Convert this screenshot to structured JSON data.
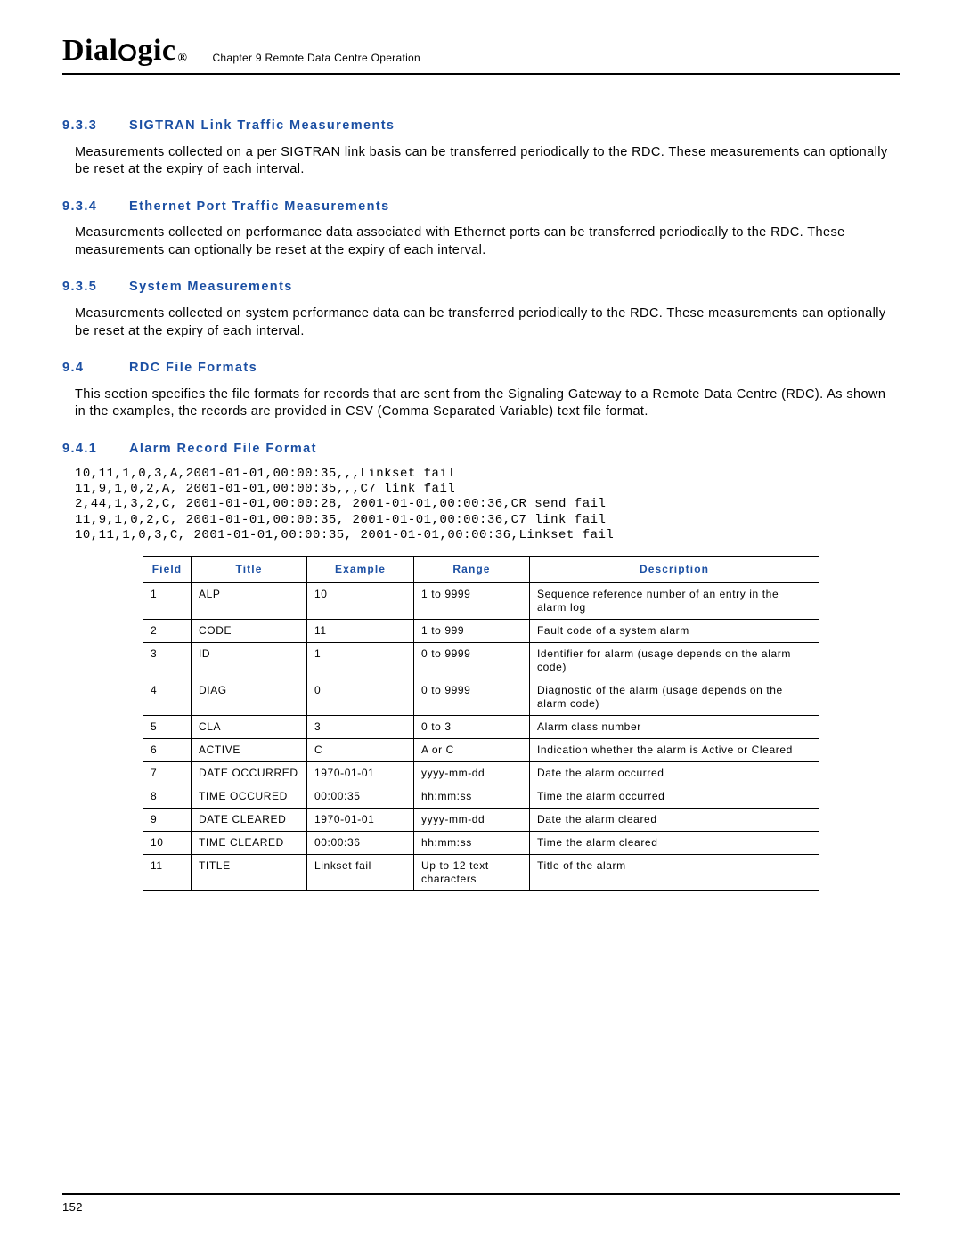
{
  "header": {
    "logo_pre": "Dial",
    "logo_post": "gic",
    "reg_mark": "®",
    "chapter_ref": "Chapter 9 Remote Data Centre Operation"
  },
  "sections": {
    "s933": {
      "num": "9.3.3",
      "title": "SIGTRAN Link Traffic Measurements",
      "body": "Measurements collected on a per SIGTRAN link basis can be transferred periodically to the RDC. These measurements can optionally be reset at the expiry of each interval."
    },
    "s934": {
      "num": "9.3.4",
      "title": "Ethernet Port Traffic Measurements",
      "body": "Measurements collected on performance data associated with Ethernet ports can be transferred periodically to the RDC. These measurements can optionally be reset at the expiry of each interval."
    },
    "s935": {
      "num": "9.3.5",
      "title": "System Measurements",
      "body": "Measurements collected on system performance data can be transferred periodically to the RDC. These measurements can optionally be reset at the expiry of each interval."
    },
    "s94": {
      "num": "9.4",
      "title": "RDC File Formats",
      "body": "This section specifies the file formats for records that are sent from the Signaling Gateway to a Remote Data Centre (RDC). As shown in the examples, the records are provided in CSV (Comma Separated Variable) text file format."
    },
    "s941": {
      "num": "9.4.1",
      "title": "Alarm Record File Format",
      "code": "10,11,1,0,3,A,2001-01-01,00:00:35,,,Linkset fail\n11,9,1,0,2,A, 2001-01-01,00:00:35,,,C7 link fail\n2,44,1,3,2,C, 2001-01-01,00:00:28, 2001-01-01,00:00:36,CR send fail\n11,9,1,0,2,C, 2001-01-01,00:00:35, 2001-01-01,00:00:36,C7 link fail\n10,11,1,0,3,C, 2001-01-01,00:00:35, 2001-01-01,00:00:36,Linkset fail"
    }
  },
  "table": {
    "headers": {
      "c1": "Field",
      "c2": "Title",
      "c3": "Example",
      "c4": "Range",
      "c5": "Description"
    },
    "rows": [
      {
        "c1": "1",
        "c2": "ALP",
        "c3": "10",
        "c4": "1 to 9999",
        "c5": "Sequence reference number of an entry in the alarm log"
      },
      {
        "c1": "2",
        "c2": "CODE",
        "c3": "11",
        "c4": "1 to 999",
        "c5": "Fault code of a system alarm"
      },
      {
        "c1": "3",
        "c2": "ID",
        "c3": "1",
        "c4": "0 to 9999",
        "c5": "Identifier for alarm (usage depends on the alarm code)"
      },
      {
        "c1": "4",
        "c2": "DIAG",
        "c3": "0",
        "c4": "0 to 9999",
        "c5": "Diagnostic of the alarm (usage depends on the alarm code)"
      },
      {
        "c1": "5",
        "c2": "CLA",
        "c3": "3",
        "c4": "0 to 3",
        "c5": "Alarm class number"
      },
      {
        "c1": "6",
        "c2": "ACTIVE",
        "c3": "C",
        "c4": "A or C",
        "c5": "Indication whether the alarm is Active or Cleared"
      },
      {
        "c1": "7",
        "c2": "DATE OCCURRED",
        "c3": "1970-01-01",
        "c4": "yyyy-mm-dd",
        "c5": "Date the alarm occurred"
      },
      {
        "c1": "8",
        "c2": "TIME OCCURED",
        "c3": "00:00:35",
        "c4": "hh:mm:ss",
        "c5": "Time the alarm occurred"
      },
      {
        "c1": "9",
        "c2": "DATE CLEARED",
        "c3": "1970-01-01",
        "c4": "yyyy-mm-dd",
        "c5": "Date the alarm cleared"
      },
      {
        "c1": "10",
        "c2": "TIME CLEARED",
        "c3": "00:00:36",
        "c4": "hh:mm:ss",
        "c5": "Time the alarm cleared"
      },
      {
        "c1": "11",
        "c2": "TITLE",
        "c3": "Linkset fail",
        "c4": "Up to 12 text characters",
        "c5": "Title of the alarm"
      }
    ]
  },
  "footer": {
    "page_number": "152"
  }
}
